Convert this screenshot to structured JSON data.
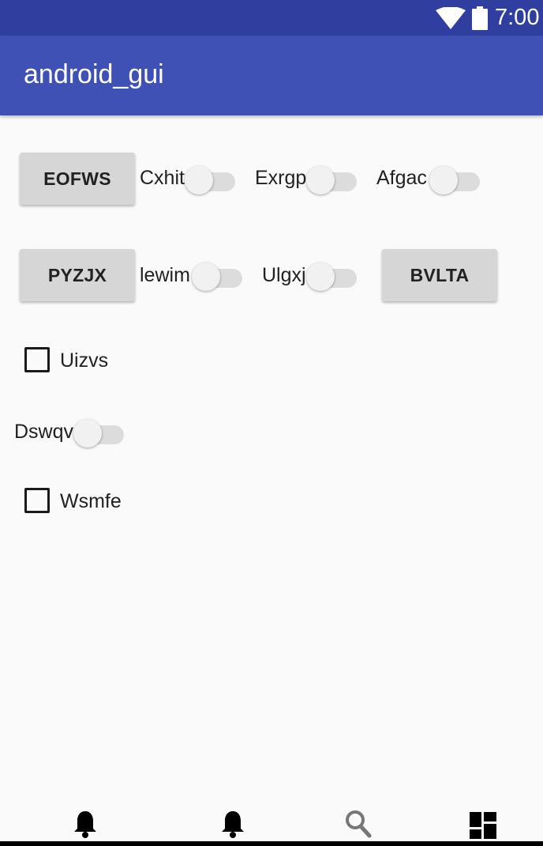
{
  "status_bar": {
    "time": "7:00",
    "icons": [
      "wifi-icon",
      "battery-icon"
    ],
    "colors": {
      "background": "#303f9f"
    }
  },
  "app_bar": {
    "title": "android_gui",
    "colors": {
      "background": "#3f51b5"
    }
  },
  "main": {
    "row1": {
      "button": "EOFWS",
      "switches": [
        {
          "label": "Cxhit",
          "checked": false
        },
        {
          "label": "Exrgp",
          "checked": false
        },
        {
          "label": "Afgac",
          "checked": false
        }
      ]
    },
    "row2": {
      "button_left": "PYZJX",
      "switches": [
        {
          "label": "lewim",
          "checked": false
        },
        {
          "label": "Ulgxj",
          "checked": false
        }
      ],
      "button_right": "BVLTA"
    },
    "checkbox1": {
      "label": "Uizvs",
      "checked": false
    },
    "switch_dswqv": {
      "label": "Dswqv",
      "checked": false
    },
    "checkbox2": {
      "label": "Wsmfe",
      "checked": false
    }
  },
  "bottom_nav": {
    "items": [
      "bell-icon",
      "bell-icon",
      "search-icon",
      "dashboard-icon"
    ]
  }
}
